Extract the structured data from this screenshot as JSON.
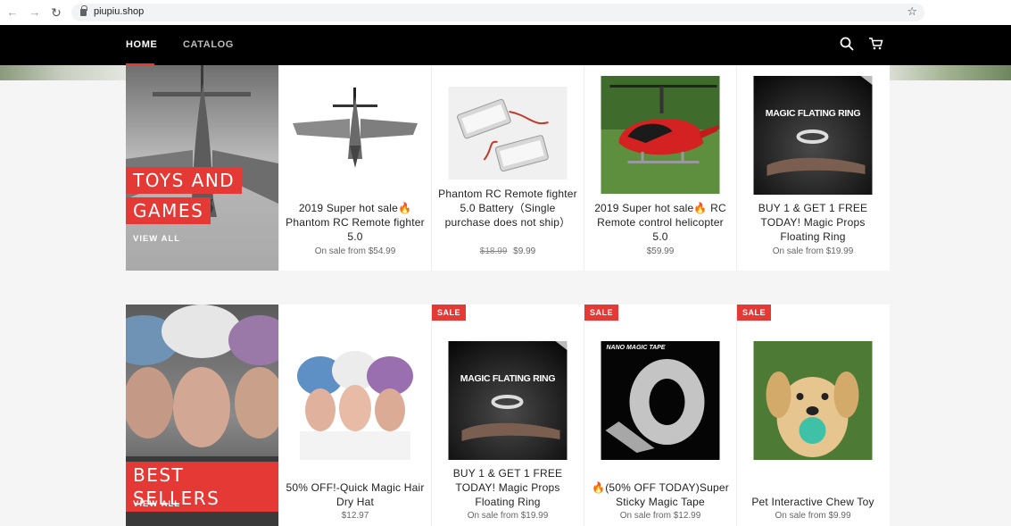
{
  "browser": {
    "url": "piupiu.shop",
    "back_glyph": "←",
    "forward_glyph": "→",
    "reload_glyph": "↻",
    "star_glyph": "☆"
  },
  "header": {
    "nav": [
      {
        "label": "HOME"
      },
      {
        "label": "CATALOG"
      }
    ]
  },
  "collections": [
    {
      "title_lines": [
        "TOYS AND",
        "GAMES"
      ],
      "view_all": "VIEW ALL",
      "products": [
        {
          "title": "2019 Super hot sale🔥 Phantom RC Remote fighter 5.0",
          "price_prefix": "On sale from",
          "price": "$54.99",
          "compare_price": "",
          "badge": ""
        },
        {
          "title": "Phantom RC Remote fighter 5.0 Battery（Single purchase does not ship）",
          "price_prefix": "",
          "price": "$9.99",
          "compare_price": "$18.99",
          "badge": ""
        },
        {
          "title": "2019 Super hot sale🔥 RC Remote control helicopter 5.0",
          "price_prefix": "",
          "price": "$59.99",
          "compare_price": "",
          "badge": ""
        },
        {
          "title": "BUY 1 & GET 1 FREE TODAY! Magic Props Floating Ring",
          "price_prefix": "On sale from",
          "price": "$19.99",
          "compare_price": "",
          "badge": ""
        }
      ]
    },
    {
      "title_lines": [
        "BEST SELLERS"
      ],
      "view_all": "VIEW ALL",
      "products": [
        {
          "title": "50% OFF!-Quick Magic Hair Dry Hat",
          "price_prefix": "",
          "price": "$12.97",
          "compare_price": "",
          "badge": ""
        },
        {
          "title": "BUY 1 & GET 1 FREE TODAY! Magic Props Floating Ring",
          "price_prefix": "On sale from",
          "price": "$19.99",
          "compare_price": "",
          "badge": "SALE"
        },
        {
          "title": "🔥(50% OFF TODAY)Super Sticky Magic Tape",
          "price_prefix": "On sale from",
          "price": "$12.99",
          "compare_price": "",
          "badge": "SALE"
        },
        {
          "title": "Pet Interactive Chew Toy",
          "price_prefix": "On sale from",
          "price": "$9.99",
          "compare_price": "",
          "badge": "SALE"
        }
      ]
    }
  ],
  "image_text": {
    "magic_ring": "MAGIC FLATING RING",
    "nano_tape": "NANO MAGIC TAPE"
  },
  "colors": {
    "accent": "#e53935",
    "header_bg": "#000000"
  }
}
